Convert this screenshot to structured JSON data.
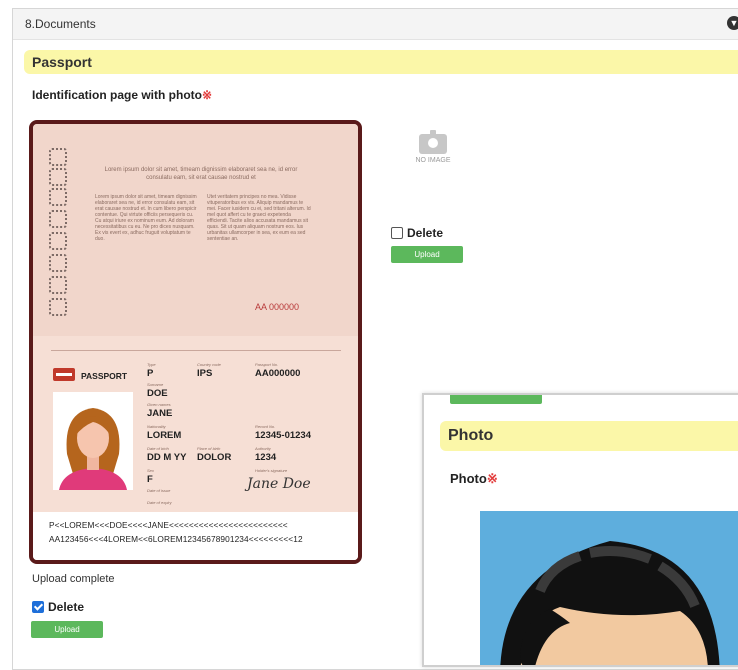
{
  "section": {
    "title": "8.Documents"
  },
  "passport": {
    "heading": "Passport",
    "field_label": "Identification page with photo",
    "required_mark": "※",
    "no_image_label": "NO IMAGE",
    "side_delete_label": "Delete",
    "side_upload_label": "Upload",
    "upload_status": "Upload complete",
    "delete_label": "Delete",
    "delete_checked": true,
    "upload_label": "Upload"
  },
  "passport_image": {
    "lorem_center": "Lorem ipsum dolor sit amet, timeam dignissim elaboraret sea ne, id error consulatu eam, sit erat causae nostrud et",
    "lorem_left": "Lorem ipsum dolor sit amet, timeam dignissim elaboraret sea ne, id error consulatu eam, sit erat causae nostrud et. In cum libero perspicir contentue. Qui virtute officiis persequeris cu. Cu atqui iriure ex nominum eum. Ad doloram necessitatibus cu eu. Ne pro dices nusquam. Ex vis evert ex, adhuc fruguit voluptatum te duo.",
    "lorem_right": "Utet veritatem principes no mea. Vidisse vituperatoribus ex vis. Aliquip mandamus te mei. Facer iusidem cu ei, sed tritani alterum. Id mel quot affert cu te graeci expetenda efficiendi. Tacite alios accusata mandamus sit quas. Sit ut quam aliquam nostrum eos. Ius urbanitas ullamcorper in sea, ex eum ea sed sententiae an.",
    "doc_number_top": "AA 000000",
    "doc_label": "PASSPORT",
    "fields": {
      "type_label": "Type",
      "type": "P",
      "country_label": "Country code",
      "country": "IPS",
      "passport_no_label": "Passport No.",
      "passport_no": "AA000000",
      "surname_label": "Surname",
      "surname": "DOE",
      "given_label": "Given names",
      "given": "JANE",
      "nationality_label": "Nationality",
      "nationality": "LOREM",
      "record_label": "Record No.",
      "record": "12345-01234",
      "dob_label": "Date of birth",
      "dob": "DD M YY",
      "pob_label": "Place of birth",
      "pob": "DOLOR",
      "authority_label": "Authority",
      "authority": "1234",
      "sex_label": "Sex",
      "sex": "F",
      "signature_label": "Holder's signature",
      "signature": "Jane Doe",
      "issue_label": "Date of issue",
      "expiry_label": "Date of expiry"
    },
    "mrz_line1": "P<<LOREM<<<DOE<<<<JANE<<<<<<<<<<<<<<<<<<<<<<<<",
    "mrz_line2": "AA123456<<<4LOREM<<6LOREM12345678901234<<<<<<<<<12"
  },
  "photo_panel": {
    "heading": "Photo",
    "field_label": "Photo",
    "required_mark": "※"
  },
  "colors": {
    "band": "#fbf7a8",
    "button": "#5cb85c",
    "required": "#e23b3b"
  }
}
